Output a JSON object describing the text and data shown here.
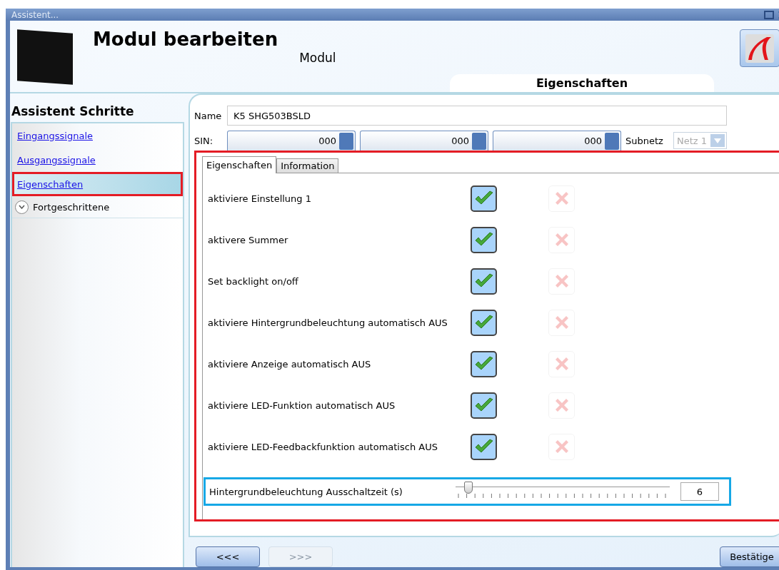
{
  "window": {
    "title": "Assistent..."
  },
  "header": {
    "title": "Modul bearbeiten",
    "subtitle": "Modul",
    "section_tab": "Eigenschaften"
  },
  "sidebar": {
    "title": "Assistent Schritte",
    "items": [
      {
        "kind": "link",
        "label": "Eingangssignale",
        "selected": false
      },
      {
        "kind": "link",
        "label": "Ausgangssignale",
        "selected": false
      },
      {
        "kind": "link",
        "label": "Eigenschaften",
        "selected": true
      },
      {
        "kind": "expander",
        "label": "Fortgeschrittene",
        "expanded": false
      }
    ]
  },
  "form": {
    "name_label": "Name",
    "name_value": "K5 SHG503BSLD",
    "sin_label": "SIN:",
    "sin_values": [
      "000",
      "000",
      "000"
    ],
    "subnet_label": "Subnetz",
    "subnet_value": "Netz 1",
    "subnet_disabled": true
  },
  "tabs": [
    {
      "label": "Eigenschaften",
      "selected": true
    },
    {
      "label": "Information",
      "selected": false
    }
  ],
  "settings": [
    {
      "label": "aktiviere Einstellung 1",
      "checked": true
    },
    {
      "label": "aktivere Summer",
      "checked": true
    },
    {
      "label": "Set backlight on/off",
      "checked": true
    },
    {
      "label": "aktiviere Hintergrundbeleuchtung automatisch AUS",
      "checked": true
    },
    {
      "label": "aktiviere Anzeige automatisch AUS",
      "checked": true
    },
    {
      "label": "aktiviere LED-Funktion automatisch AUS",
      "checked": true
    },
    {
      "label": "aktiviere LED-Feedbackfunktion automatisch AUS",
      "checked": true
    }
  ],
  "slider": {
    "label": "Hintergrundbeleuchtung Ausschaltzeit (s)",
    "level": 0.06,
    "value": "6"
  },
  "buttons": {
    "back": {
      "label": "<<<",
      "disabled": false
    },
    "next": {
      "label": ">>>",
      "disabled": true
    },
    "confirm": {
      "label": "Bestätige",
      "disabled": false
    }
  }
}
